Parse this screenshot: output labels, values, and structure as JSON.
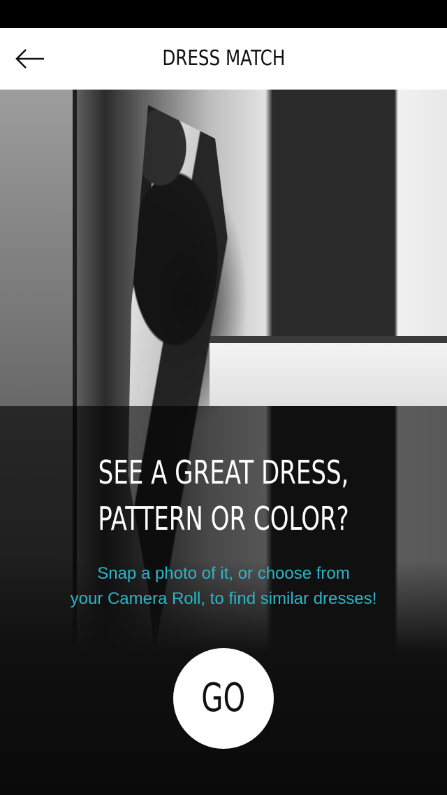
{
  "header": {
    "title": "DRESS MATCH",
    "back_icon": "arrow-left-icon"
  },
  "hero": {
    "image_desc_icon": "photo-background",
    "headline_line1": "SEE A GREAT DRESS,",
    "headline_line2": "PATTERN OR COLOR?",
    "subtext_line1": "Snap a photo of it, or choose from",
    "subtext_line2": "your Camera Roll, to find similar dresses!",
    "go_label": "GO"
  },
  "colors": {
    "accent": "#2bb5c6",
    "nav_background": "#ffffff",
    "overlay": "#000000"
  }
}
